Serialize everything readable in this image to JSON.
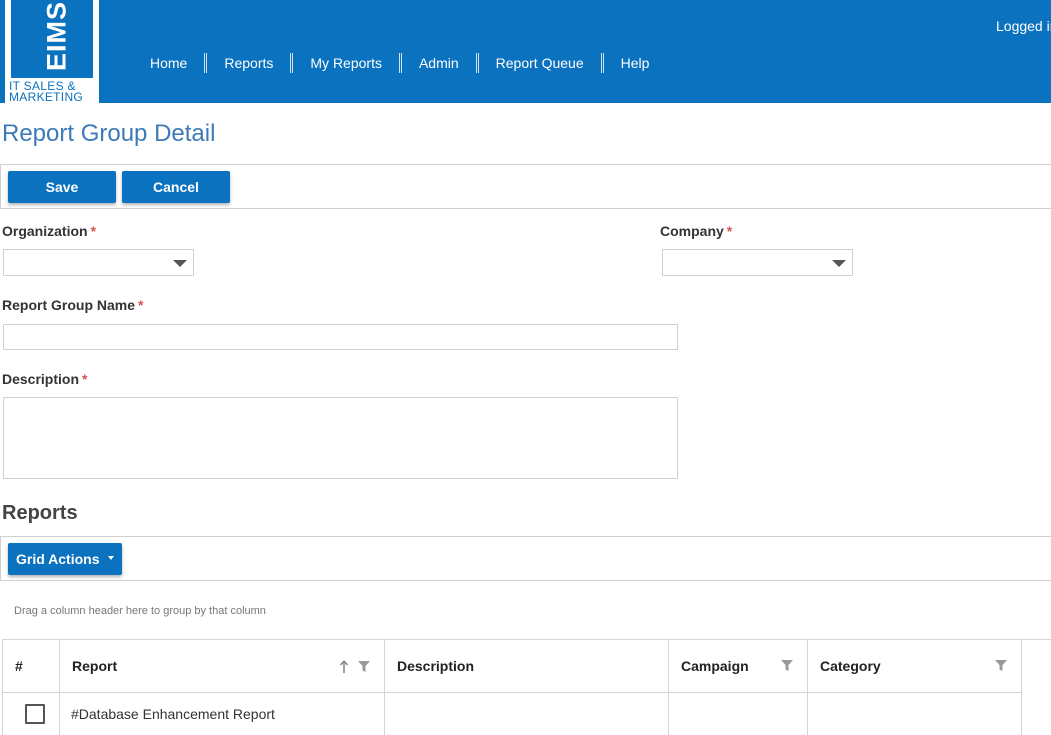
{
  "header": {
    "logo": {
      "brand": "EIMS",
      "line1": "IT SALES &",
      "line2": "MARKETING"
    },
    "nav": [
      "Home",
      "Reports",
      "My Reports",
      "Admin",
      "Report Queue",
      "Help"
    ],
    "logged_in_text": "Logged in",
    "colors": {
      "bar": "#0a72bf"
    }
  },
  "page": {
    "title": "Report Group Detail"
  },
  "toolbar": {
    "save_label": "Save",
    "cancel_label": "Cancel"
  },
  "form": {
    "organization": {
      "label": "Organization",
      "required_mark": "*",
      "value": ""
    },
    "company": {
      "label": "Company",
      "required_mark": "*",
      "value": ""
    },
    "report_group_name": {
      "label": "Report Group Name",
      "required_mark": "*",
      "value": ""
    },
    "description": {
      "label": "Description",
      "required_mark": "*",
      "value": ""
    }
  },
  "reports": {
    "title": "Reports",
    "grid_actions_label": "Grid Actions",
    "group_hint": "Drag a column header here to group by that column",
    "columns": [
      "#",
      "Report",
      "Description",
      "Campaign",
      "Category"
    ],
    "rows": [
      {
        "checked": false,
        "report": "#Database Enhancement Report",
        "description": "",
        "campaign": "",
        "category": ""
      }
    ]
  }
}
